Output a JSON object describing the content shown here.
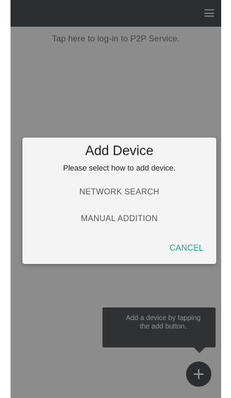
{
  "header": {
    "menu_icon": "hamburger-menu-icon",
    "login_hint": "Tap here to log-in to P2P Service."
  },
  "dialog": {
    "title": "Add Device",
    "subtitle": "Please select how to add device.",
    "options": [
      "NETWORK SEARCH",
      "MANUAL ADDITION"
    ],
    "cancel_label": "CANCEL"
  },
  "tooltip": {
    "text": "Add a device by tapping the add button."
  },
  "fab": {
    "icon": "plus-icon"
  },
  "colors": {
    "accent": "#16a085",
    "topbar": "#2b2e30",
    "overlay": "#8c8c8c",
    "dialog_bg": "#f4f4f4"
  }
}
